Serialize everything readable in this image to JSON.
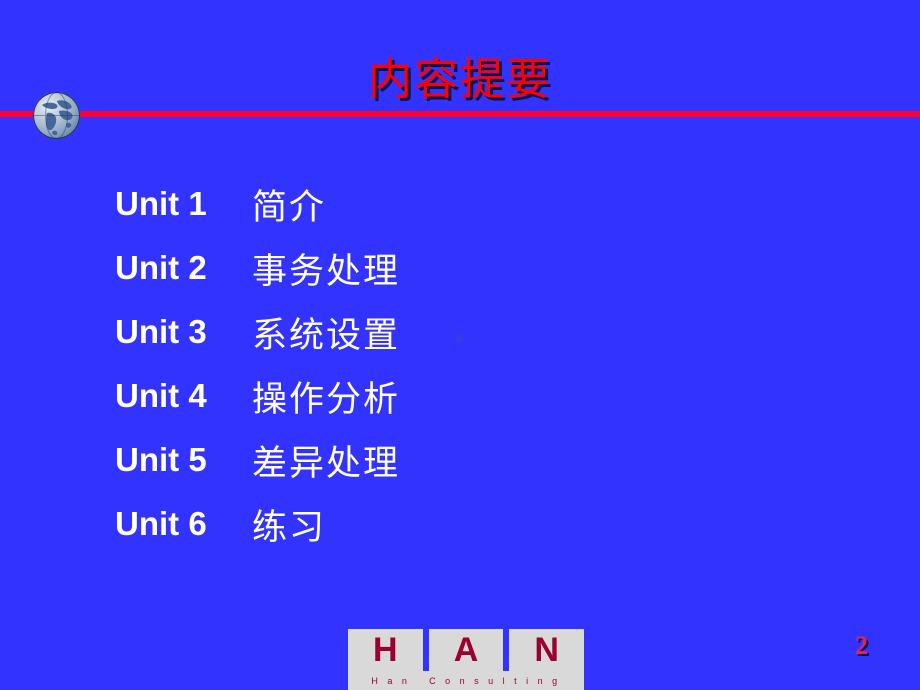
{
  "slide": {
    "title": "内容提要",
    "page_number": "2",
    "background_color": "#3333ff",
    "title_color": "#ff0000",
    "rule_color": "#ff0033",
    "text_color": "#ffffff"
  },
  "bullet_icon": {
    "name": "globe-icon"
  },
  "outline": {
    "items": [
      {
        "unit": "Unit 1",
        "topic": "简介"
      },
      {
        "unit": "Unit 2",
        "topic": "事务处理"
      },
      {
        "unit": "Unit 3",
        "topic": "系统设置"
      },
      {
        "unit": "Unit 4",
        "topic": "操作分析"
      },
      {
        "unit": "Unit 5",
        "topic": "差异处理"
      },
      {
        "unit": "Unit 6",
        "topic": "练习"
      }
    ]
  },
  "logo": {
    "letters": [
      "H",
      "A",
      "N"
    ],
    "caption_words": [
      "H a n",
      "C o n s u l t i n g"
    ],
    "mark_color": "#9b0030",
    "tile_color": "#d9d9d9"
  }
}
